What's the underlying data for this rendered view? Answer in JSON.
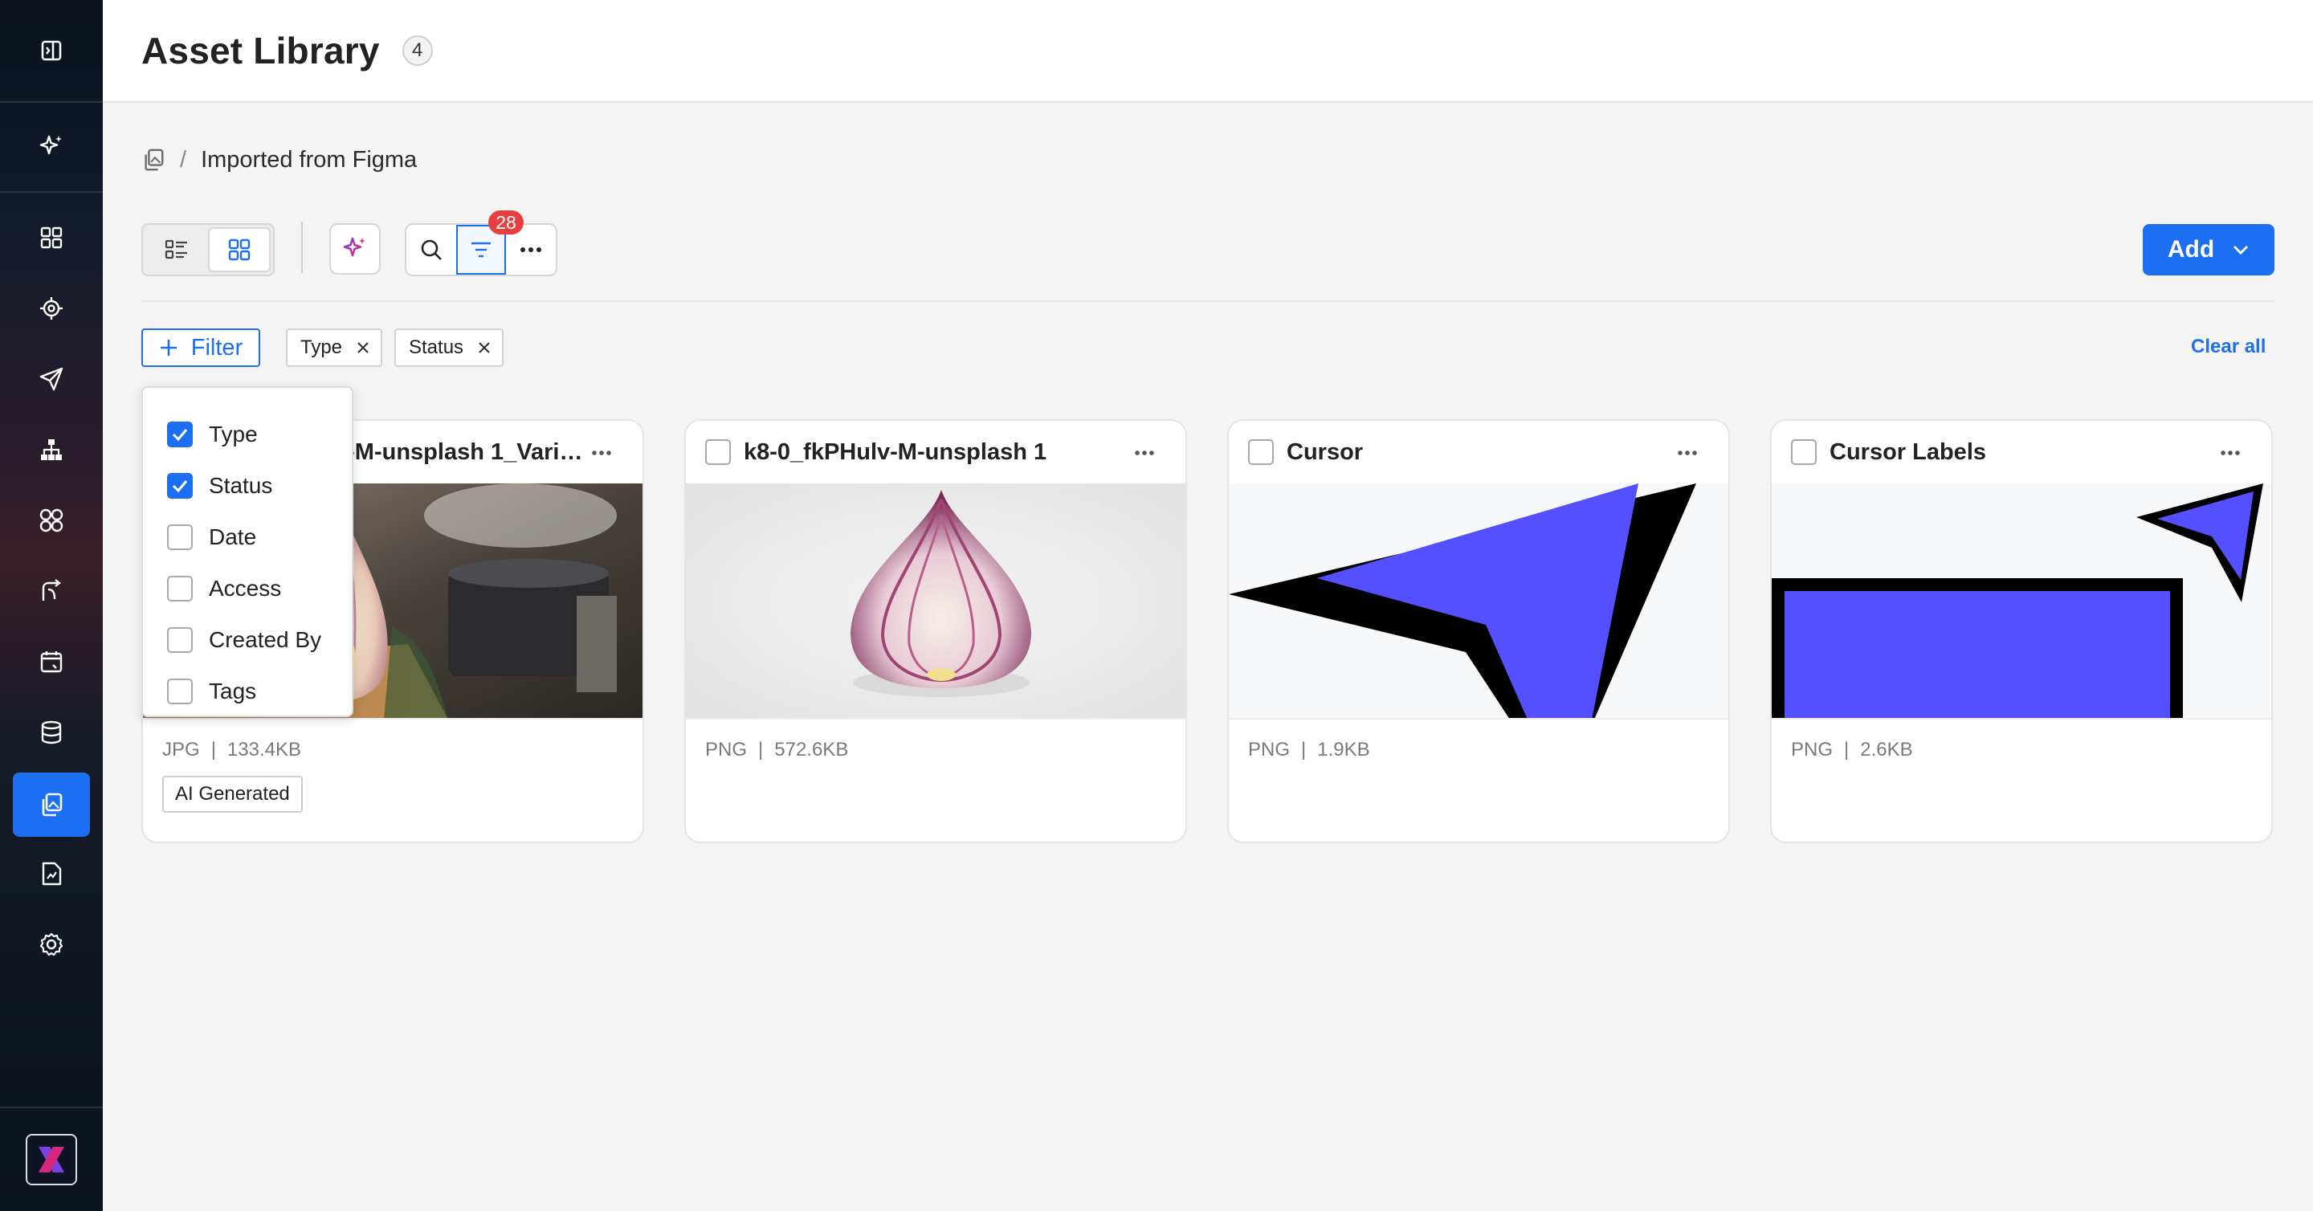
{
  "header": {
    "title": "Asset Library",
    "count": "4"
  },
  "breadcrumb": {
    "current": "Imported from Figma",
    "separator": "/"
  },
  "toolbar": {
    "filter_count": "28",
    "add_label": "Add"
  },
  "filters": {
    "button_label": "Filter",
    "chips": [
      "Type",
      "Status"
    ],
    "clear_all": "Clear all",
    "dropdown": [
      {
        "label": "Type",
        "checked": true
      },
      {
        "label": "Status",
        "checked": true
      },
      {
        "label": "Date",
        "checked": false
      },
      {
        "label": "Access",
        "checked": false
      },
      {
        "label": "Created By",
        "checked": false
      },
      {
        "label": "Tags",
        "checked": false
      }
    ]
  },
  "assets": [
    {
      "title": "k8-0_fkPHulv-M-unsplash 1_Varia…",
      "format": "JPG",
      "size": "133.4KB",
      "tag": "AI Generated"
    },
    {
      "title": "k8-0_fkPHulv-M-unsplash 1",
      "format": "PNG",
      "size": "572.6KB"
    },
    {
      "title": "Cursor",
      "format": "PNG",
      "size": "1.9KB"
    },
    {
      "title": "Cursor Labels",
      "format": "PNG",
      "size": "2.6KB"
    }
  ],
  "meta_separator": "|",
  "colors": {
    "accent": "#1d6ff2",
    "badge": "#e5403f",
    "cursor_fill": "#5550ff"
  },
  "sidebar": {
    "icons": [
      "sidebar-toggle-icon",
      "ai-sparkle-icon",
      "dashboard-icon",
      "target-icon",
      "send-icon",
      "hierarchy-icon",
      "components-icon",
      "flow-icon",
      "calendar-icon",
      "database-icon",
      "asset-library-icon",
      "report-icon",
      "settings-icon",
      "brand-logo"
    ]
  }
}
